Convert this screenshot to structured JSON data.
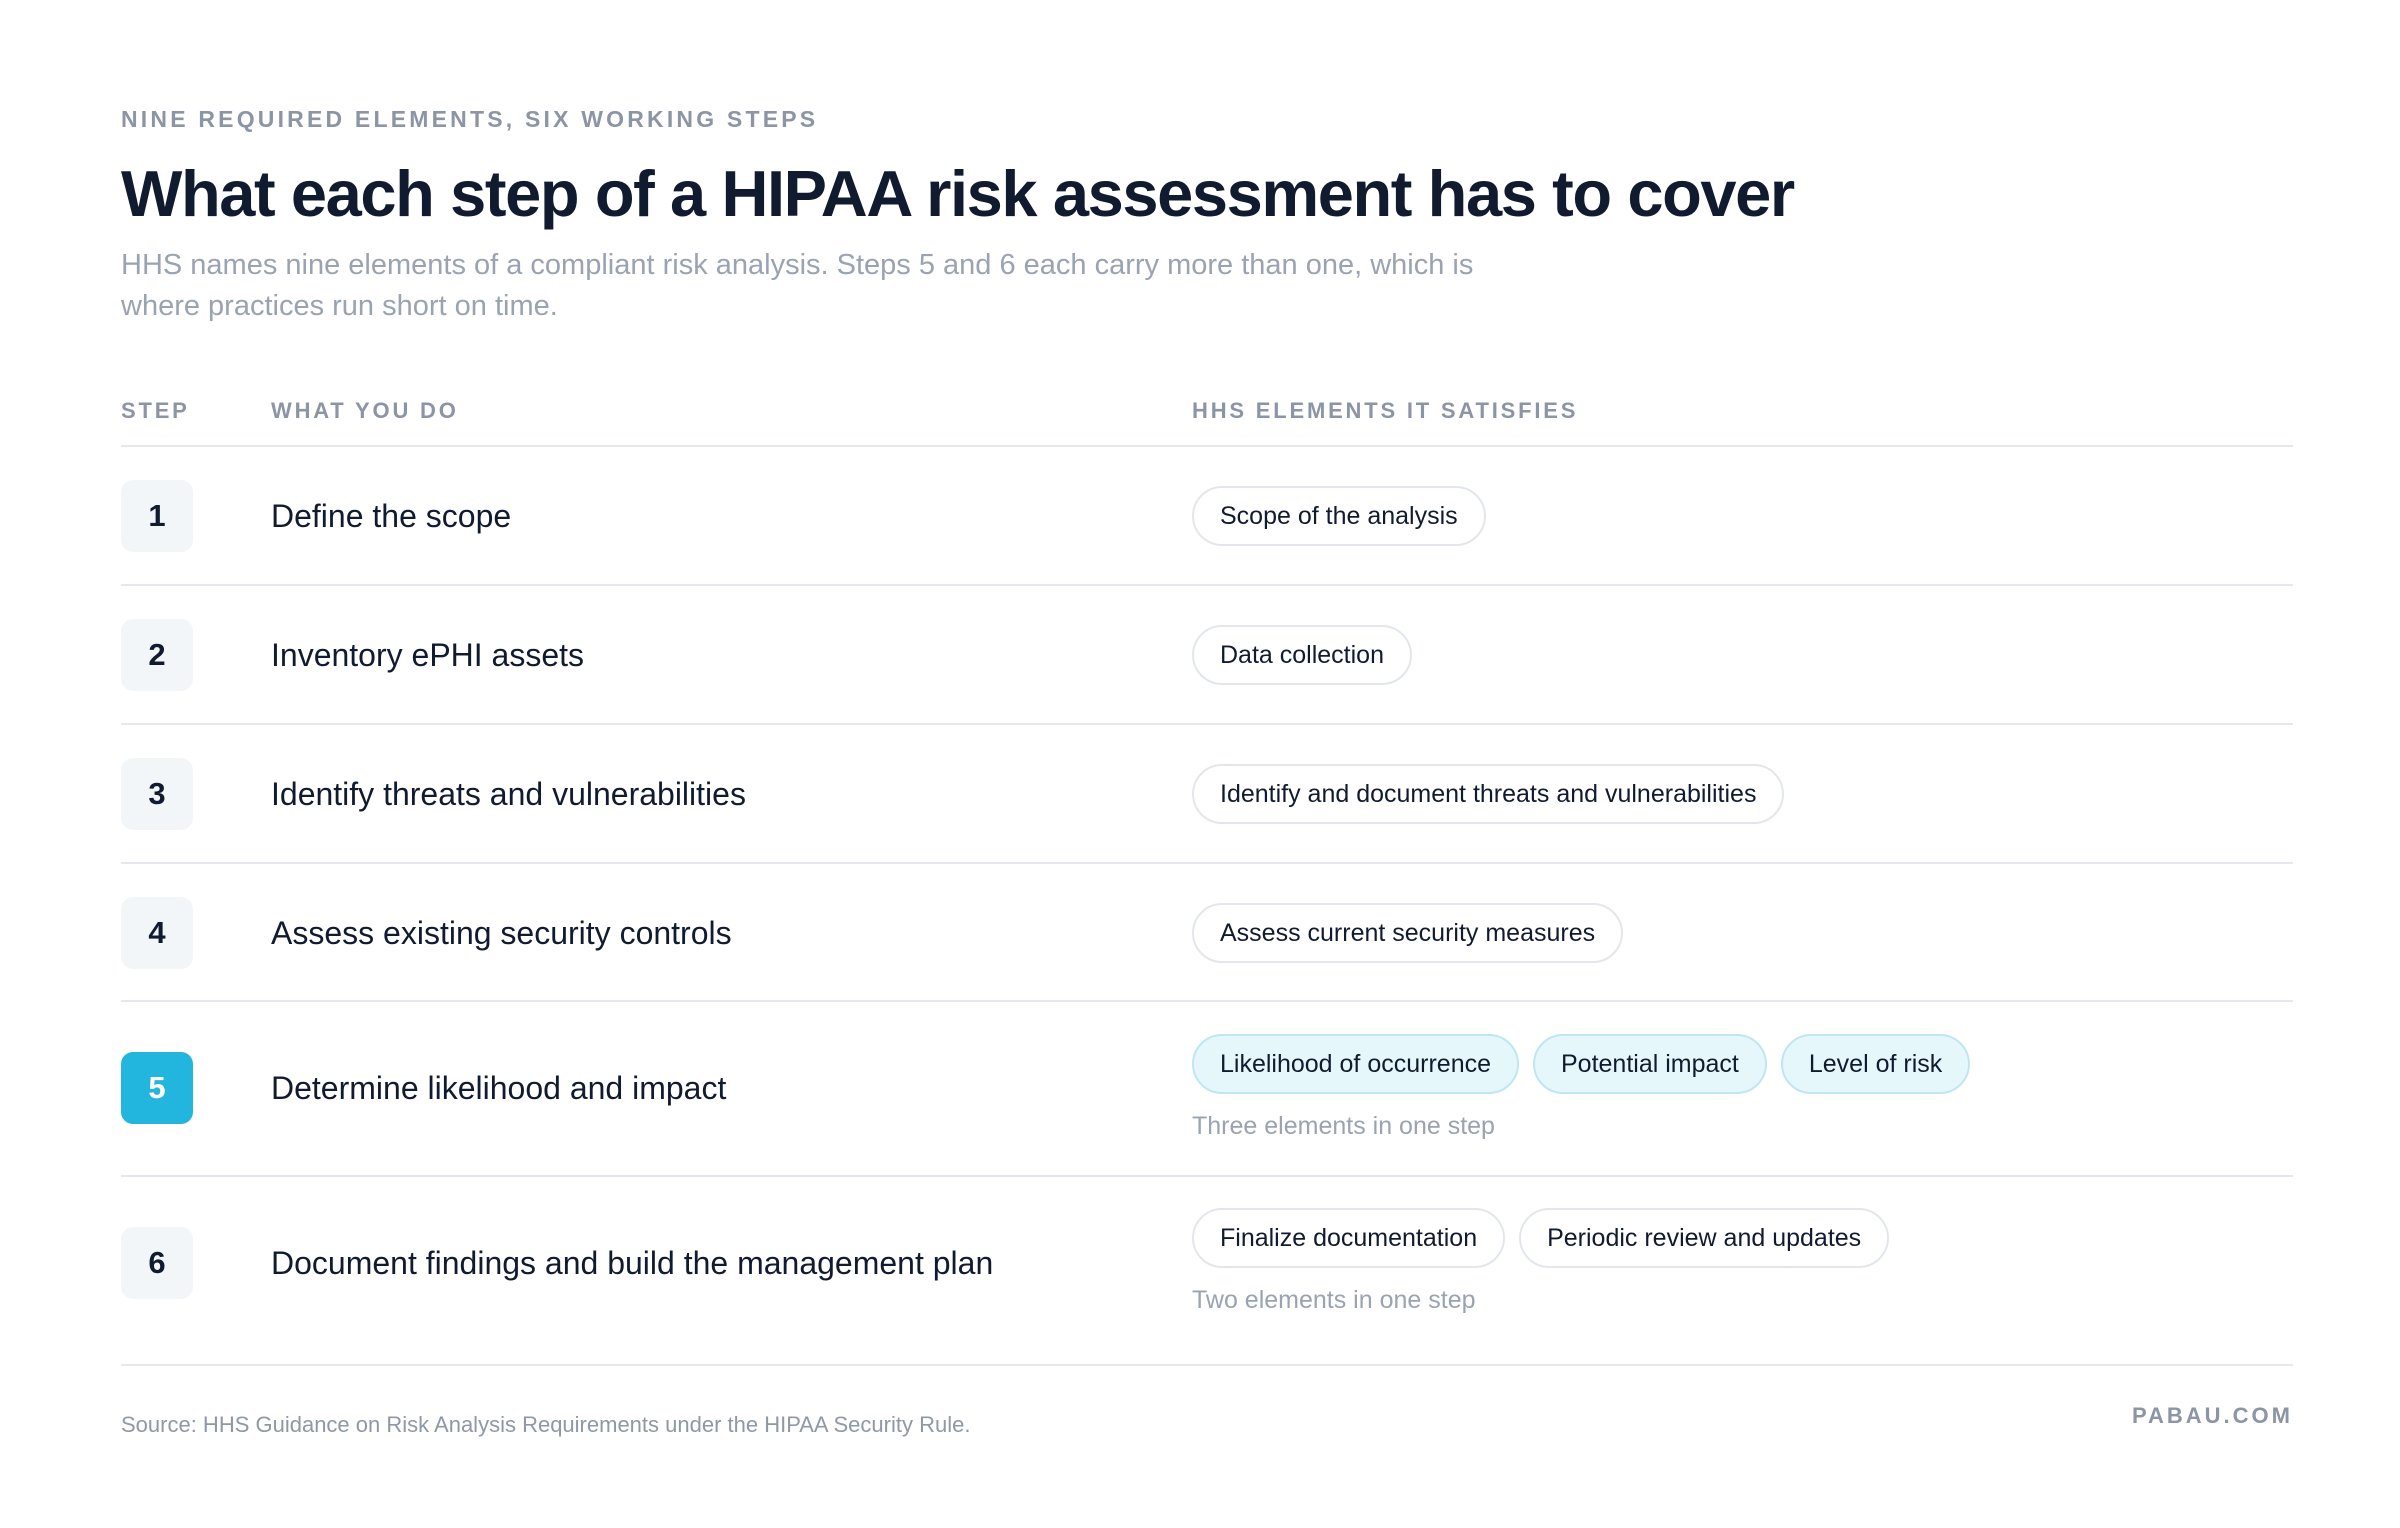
{
  "header": {
    "eyebrow": "NINE REQUIRED ELEMENTS, SIX WORKING STEPS",
    "title": "What each step of a HIPAA risk assessment has to cover",
    "subtitle": "HHS names nine elements of a compliant risk analysis. Steps 5 and 6 each carry more than one, which is where practices run short on time."
  },
  "table": {
    "columns": {
      "step": "STEP",
      "action": "WHAT YOU DO",
      "elements": "HHS ELEMENTS IT SATISFIES"
    },
    "rows": [
      {
        "step": "1",
        "action": "Define the scope",
        "elements": [
          "Scope of the analysis"
        ],
        "highlighted": false
      },
      {
        "step": "2",
        "action": "Inventory ePHI assets",
        "elements": [
          "Data collection"
        ],
        "highlighted": false
      },
      {
        "step": "3",
        "action": "Identify threats and vulnerabilities",
        "elements": [
          "Identify and document threats and vulnerabilities"
        ],
        "highlighted": false
      },
      {
        "step": "4",
        "action": "Assess existing security controls",
        "elements": [
          "Assess current security measures"
        ],
        "highlighted": false
      },
      {
        "step": "5",
        "action": "Determine likelihood and impact",
        "elements": [
          "Likelihood of occurrence",
          "Potential impact",
          "Level of risk"
        ],
        "note": "Three elements in one step",
        "highlighted": true
      },
      {
        "step": "6",
        "action": "Document findings and build the management plan",
        "elements": [
          "Finalize documentation",
          "Periodic review and updates"
        ],
        "note": "Two elements in one step",
        "highlighted": false
      }
    ]
  },
  "footer": {
    "source": "Source: HHS Guidance on Risk Analysis Requirements under the HIPAA Security Rule.",
    "brand": "PABAU.COM"
  },
  "colors": {
    "accent": "#22b5de",
    "accent_chip_bg": "#e6f7fc",
    "text_dark": "#111b30",
    "text_muted": "#9aa3b1"
  }
}
